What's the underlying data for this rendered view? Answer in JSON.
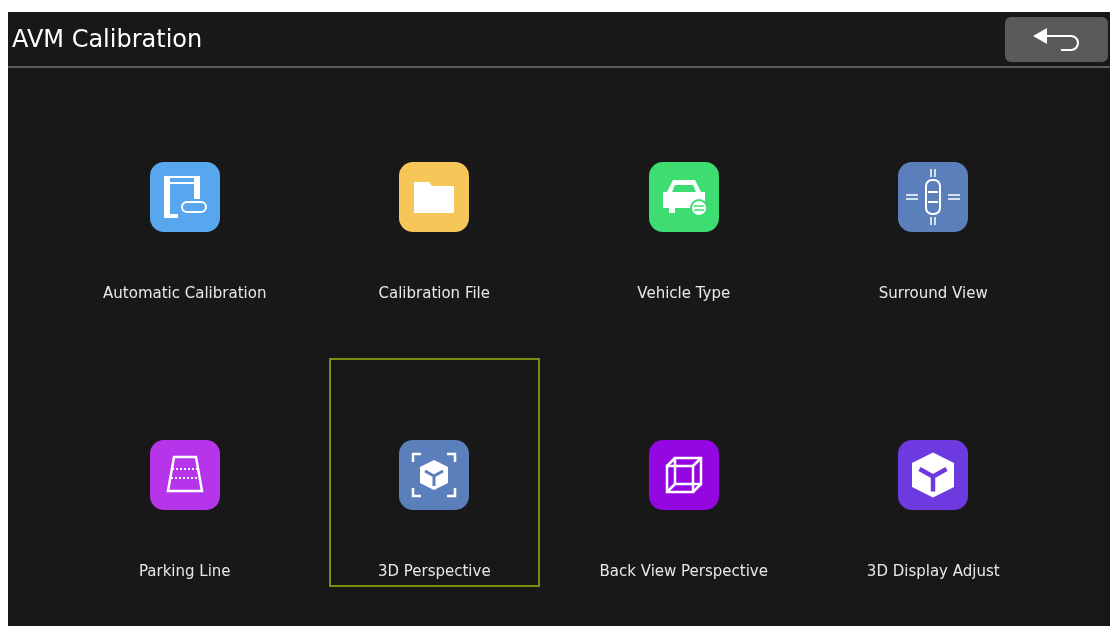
{
  "header": {
    "title": "AVM Calibration"
  },
  "items": [
    {
      "label": "Automatic Calibration",
      "kind": "auto",
      "color": "#58a6ee",
      "selected": false
    },
    {
      "label": "Calibration File",
      "kind": "folder",
      "color": "#f6c659",
      "selected": false
    },
    {
      "label": "Vehicle Type",
      "kind": "car",
      "color": "#3ddd72",
      "selected": false
    },
    {
      "label": "Surround View",
      "kind": "surround",
      "color": "#5b7fbb",
      "selected": false
    },
    {
      "label": "Parking Line",
      "kind": "parking",
      "color": "#b635ea",
      "selected": false
    },
    {
      "label": "3D Perspective",
      "kind": "focus-cube",
      "color": "#5b7fbb",
      "selected": true
    },
    {
      "label": "Back View Perspective",
      "kind": "wire-cube",
      "color": "#9407e0",
      "selected": false
    },
    {
      "label": "3D Display Adjust",
      "kind": "cube",
      "color": "#6d3ae0",
      "selected": false
    }
  ]
}
